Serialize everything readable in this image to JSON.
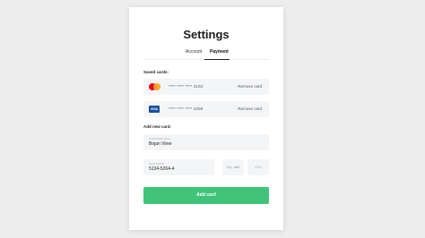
{
  "page": {
    "title": "Settings"
  },
  "tabs": [
    {
      "label": "Account",
      "active": false
    },
    {
      "label": "Payment",
      "active": true
    }
  ],
  "saved_cards": {
    "label": "Saved cards:",
    "items": [
      {
        "brand": "mastercard-icon",
        "number": "**** **** **** 3193",
        "action": "Remove card"
      },
      {
        "brand": "visa-icon",
        "brand_text": "VISA",
        "number": "**** **** **** 4296",
        "action": "Remove card"
      }
    ]
  },
  "new_card": {
    "label": "Add new card:",
    "cardholder": {
      "label": "Card holder name",
      "value": "Bojan Viner"
    },
    "number": {
      "label": "Card number",
      "value": "5134-5264-4"
    },
    "expiry": {
      "placeholder": "Exp. date"
    },
    "cvv": {
      "placeholder": "CVV"
    }
  },
  "submit_label": "Add card",
  "colors": {
    "accent": "#40c47a",
    "visa": "#1a4ea1",
    "mastercard_red": "#eb001b",
    "mastercard_orange": "#f79e1b"
  }
}
